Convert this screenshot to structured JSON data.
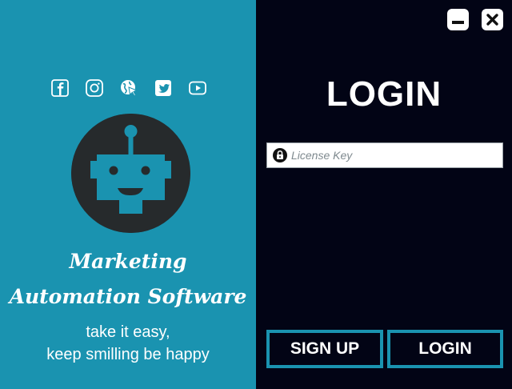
{
  "brand": {
    "line1": "Marketing",
    "line2": "Automation Software",
    "tagline1": "take it easy,",
    "tagline2": "keep smilling be happy"
  },
  "social": [
    {
      "icon": "facebook-icon"
    },
    {
      "icon": "instagram-icon"
    },
    {
      "icon": "website-icon"
    },
    {
      "icon": "twitter-icon"
    },
    {
      "icon": "youtube-icon"
    }
  ],
  "login": {
    "title": "LOGIN",
    "license_placeholder": "License Key",
    "license_value": "",
    "signup_label": "SIGN UP",
    "login_label": "LOGIN"
  },
  "colors": {
    "left_panel": "#1a93b0",
    "right_panel": "#020415",
    "accent": "#1a93b0"
  }
}
